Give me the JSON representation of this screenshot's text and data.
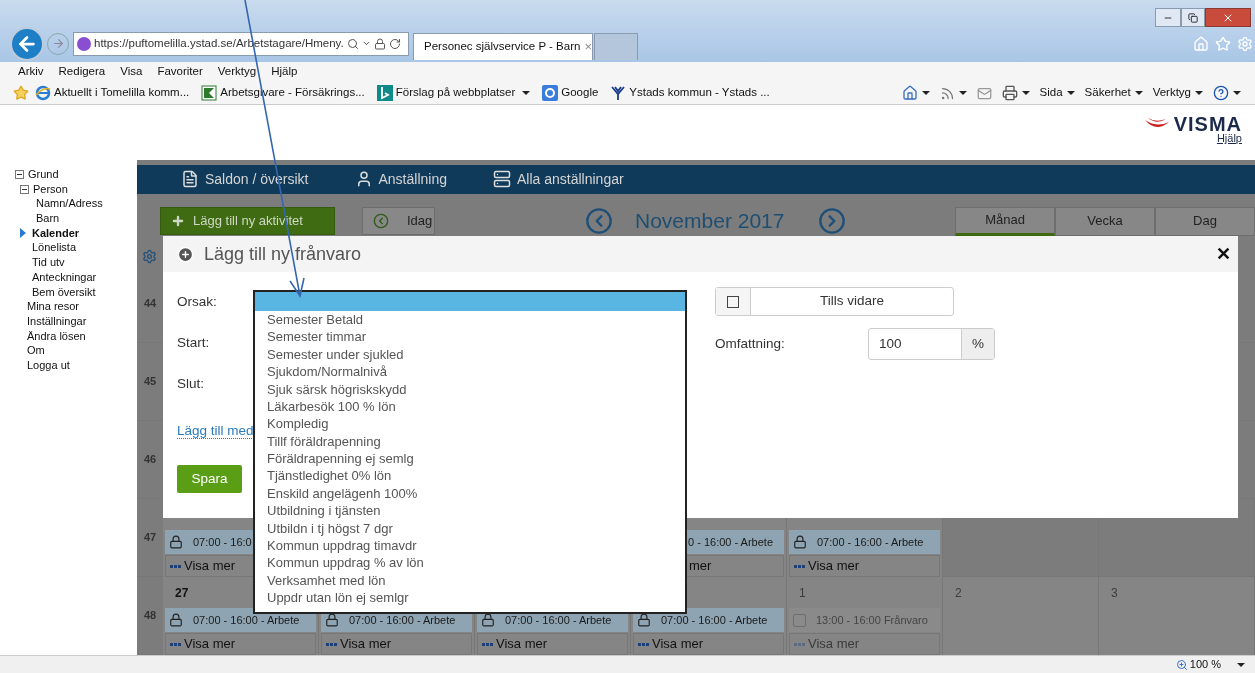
{
  "browser": {
    "url": "https://puftomelilla.ystad.se/Arbetstagare/Hmeny.",
    "tabs": [
      {
        "title": "Personec självservice P - Barn",
        "close": "×",
        "selected": true
      }
    ],
    "menu": [
      "Arkiv",
      "Redigera",
      "Visa",
      "Favoriter",
      "Verktyg",
      "Hjälp"
    ],
    "favorites": [
      {
        "kind": "ie",
        "label": "Aktuellt i Tomelilla komm..."
      },
      {
        "kind": "flag",
        "label": "Arbetsgivare - Försäkrings..."
      },
      {
        "kind": "bing",
        "label": "Förslag på webbplatser",
        "dropdown": true
      },
      {
        "kind": "google",
        "label": "Google"
      },
      {
        "kind": "fork",
        "label": "Ystads kommun - Ystads ..."
      }
    ],
    "commands": [
      {
        "kind": "home"
      },
      {
        "kind": "rss"
      },
      {
        "kind": "mail"
      },
      {
        "kind": "print"
      },
      {
        "kind": "text",
        "label": "Sida"
      },
      {
        "kind": "text",
        "label": "Säkerhet"
      },
      {
        "kind": "text",
        "label": "Verktyg"
      },
      {
        "kind": "help"
      }
    ],
    "zoom": "100 %"
  },
  "header": {
    "logo": "VISMA",
    "help_link": "Hjälp"
  },
  "sidebar": {
    "items": [
      {
        "label": "Grund",
        "expanded": true,
        "selected": false,
        "children": [
          {
            "label": "Person",
            "expanded": true,
            "selected": false,
            "children": [
              {
                "label": "Namn/Adress",
                "selected": false
              },
              {
                "label": "Barn",
                "selected": false
              }
            ]
          },
          {
            "label": "Kalender",
            "selected": true
          },
          {
            "label": "Lönelista",
            "selected": false
          },
          {
            "label": "Tid utv",
            "selected": false
          },
          {
            "label": "Anteckningar",
            "selected": false
          },
          {
            "label": "Bem översikt",
            "selected": false
          }
        ]
      },
      {
        "label": "Mina resor",
        "selected": false
      },
      {
        "label": "Inställningar",
        "selected": false
      },
      {
        "label": "Ändra lösen",
        "selected": false
      },
      {
        "label": "Om",
        "selected": false
      },
      {
        "label": "Logga ut",
        "selected": false
      }
    ]
  },
  "nav": [
    {
      "kind": "document",
      "label": "Saldon / översikt"
    },
    {
      "kind": "person",
      "label": "Anställning"
    },
    {
      "kind": "list",
      "label": "Alla anställningar"
    }
  ],
  "toolbar": {
    "add_button": "Lägg till ny aktivitet",
    "today_button": "Idag",
    "month_title": "November 2017",
    "views": [
      {
        "label": "Månad",
        "selected": true
      },
      {
        "label": "Vecka",
        "selected": false
      },
      {
        "label": "Dag",
        "selected": false
      }
    ]
  },
  "calendar": {
    "week_numbers": [
      "44",
      "45",
      "46",
      "47",
      "48"
    ],
    "rows": [
      [
        {
          "kind": "work",
          "time": "07:00 - 16:0",
          "more": "Visa mer"
        },
        {
          "kind": "empty"
        },
        {
          "kind": "empty"
        },
        {
          "kind": "clipped",
          "time": "0 - 16:00 - Arbete",
          "more": "mer"
        },
        {
          "kind": "work",
          "time": "07:00 - 16:00 - Arbete",
          "more": "Visa mer"
        },
        {
          "kind": "empty"
        },
        {
          "kind": "empty"
        }
      ],
      [
        {
          "kind": "work",
          "day": "27",
          "next_month": false,
          "time": "07:00 - 16:00 - Arbete",
          "more": "Visa mer"
        },
        {
          "kind": "work",
          "time": "07:00 - 16:00 - Arbete",
          "more": "Visa mer"
        },
        {
          "kind": "work",
          "time": "07:00 - 16:00 - Arbete",
          "more": "Visa mer"
        },
        {
          "kind": "work",
          "time": "07:00 - 16:00 - Arbete",
          "more": "Visa mer"
        },
        {
          "kind": "absence",
          "day": "1",
          "next_month": true,
          "time": "13:00 - 16:00 Frånvaro",
          "more": "Visa mer"
        },
        {
          "kind": "empty",
          "day": "2",
          "next_month": true
        },
        {
          "kind": "empty",
          "day": "3",
          "next_month": true
        }
      ]
    ]
  },
  "dialog": {
    "title": "Lägg till ny frånvaro",
    "close": "✕",
    "reason_label": "Orsak:",
    "start_label": "Start:",
    "end_label": "Slut:",
    "link": "Lägg till med",
    "save_button": "Spara",
    "until_further": {
      "label": "Tills vidare",
      "checked": false
    },
    "extent_label": "Omfattning:",
    "extent_value": "100",
    "extent_unit": "%"
  },
  "dropdown": {
    "blank_option": {
      "selected": true
    },
    "options": [
      {
        "label": "Semester Betald",
        "selected": false
      },
      {
        "label": "Semester timmar",
        "selected": false
      },
      {
        "label": "Semester under sjukled",
        "selected": false
      },
      {
        "label": "Sjukdom/Normalnivå",
        "selected": false
      },
      {
        "label": "Sjuk särsk högriskskydd",
        "selected": false
      },
      {
        "label": "Läkarbesök 100 % lön",
        "selected": false
      },
      {
        "label": "Kompledig",
        "selected": false
      },
      {
        "label": "Tillf föräldrapenning",
        "selected": false
      },
      {
        "label": "Föräldrapenning ej semlg",
        "selected": false
      },
      {
        "label": "Tjänstledighet 0% lön",
        "selected": false
      },
      {
        "label": "Enskild angelägenh 100%",
        "selected": false
      },
      {
        "label": "Utbildning i tjänsten",
        "selected": false
      },
      {
        "label": "Utbildn i tj högst 7 dgr",
        "selected": false
      },
      {
        "label": "Kommun uppdrag timavdr",
        "selected": false
      },
      {
        "label": "Kommun uppdrag % av lön",
        "selected": false
      },
      {
        "label": "Verksamhet med lön",
        "selected": false
      },
      {
        "label": "Uppdr utan lön ej semlgr",
        "selected": false
      }
    ]
  }
}
